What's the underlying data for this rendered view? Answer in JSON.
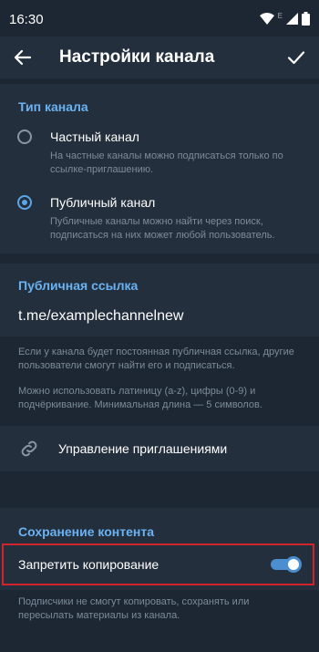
{
  "status_bar": {
    "time": "16:30",
    "network_label": "E"
  },
  "header": {
    "title": "Настройки канала"
  },
  "channel_type": {
    "heading": "Тип канала",
    "options": [
      {
        "label": "Частный канал",
        "description": "На частные каналы можно подписаться только по ссылке-приглашению.",
        "selected": false
      },
      {
        "label": "Публичный канал",
        "description": "Публичные каналы можно найти через поиск, подписаться на них может любой пользователь.",
        "selected": true
      }
    ]
  },
  "public_link": {
    "heading": "Публичная ссылка",
    "value": "t.me/examplechannelnew",
    "info_1": "Если у канала будет постоянная публичная ссылка, другие пользователи смогут найти его и подписаться.",
    "info_2": "Можно использовать латиницу (a-z), цифры (0-9) и подчёркивание. Минимальная длина — 5 символов."
  },
  "invites": {
    "label": "Управление приглашениями"
  },
  "content_saving": {
    "heading": "Сохранение контента",
    "toggle_label": "Запретить копирование",
    "toggle_on": true,
    "info": "Подписчики не смогут копировать, сохранять или пересылать материалы из канала."
  },
  "colors": {
    "accent": "#6ab2f2",
    "background": "#1c2733",
    "surface": "#242f3d",
    "highlight": "#d2232a"
  }
}
